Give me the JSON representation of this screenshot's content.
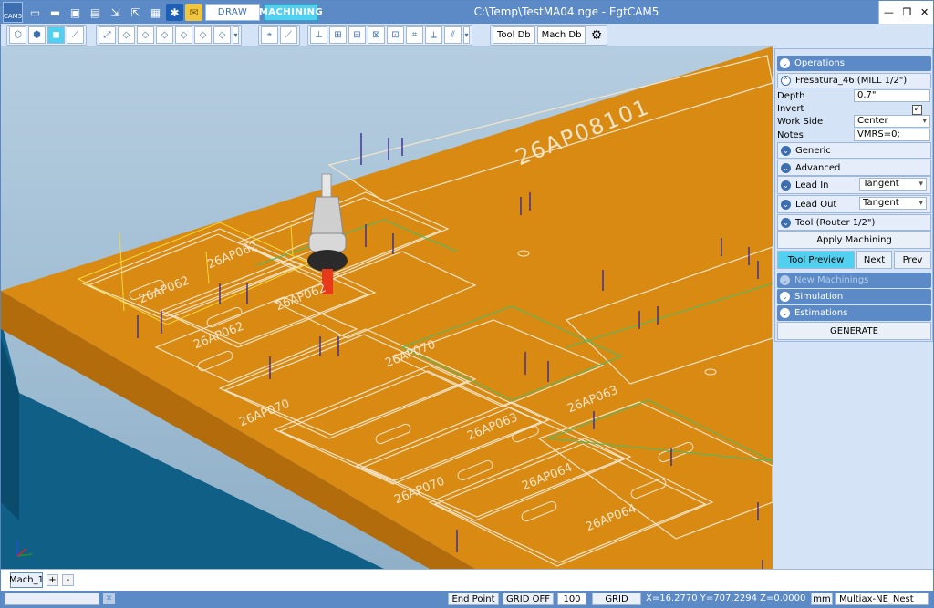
{
  "titlebar": {
    "title": "C:\\Temp\\TestMA04.nge - EgtCAM5",
    "app_icon_label": "CAM5",
    "tab_draw": "DRAW",
    "tab_machining": "MACHINING",
    "minimize": "—",
    "maximize": "❐",
    "close": "✕"
  },
  "toolbar": {
    "tool_db": "Tool Db",
    "mach_db": "Mach Db"
  },
  "panel": {
    "operations": "Operations",
    "current_op": "Fresatura_46 (MILL 1/2\")",
    "depth_label": "Depth",
    "depth_value": "0.7\"",
    "invert_label": "Invert",
    "invert_checked": true,
    "work_side_label": "Work Side",
    "work_side_value": "Center",
    "notes_label": "Notes",
    "notes_value": "VMRS=0;",
    "generic": "Generic",
    "advanced": "Advanced",
    "lead_in_label": "Lead In",
    "lead_in_value": "Tangent",
    "lead_out_label": "Lead Out",
    "lead_out_value": "Tangent",
    "tool_label": "Tool (Router 1/2\")",
    "apply_machining": "Apply Machining",
    "tool_preview": "Tool Preview",
    "next": "Next",
    "prev": "Prev",
    "new_machinings": "New Machinings",
    "simulation": "Simulation",
    "estimations": "Estimations",
    "generate": "GENERATE"
  },
  "viewport": {
    "part_labels": [
      "26AP08101",
      "26AP062",
      "26AP062",
      "26AP062",
      "26AP062",
      "26AP070",
      "26AP070",
      "26AP064",
      "26AP070",
      "26AP064",
      "26AP063",
      "26AP063"
    ]
  },
  "machbar": {
    "tab": "Mach_1",
    "add": "+",
    "remove": "-"
  },
  "statusbar": {
    "end_point": "End Point",
    "grid_off": "GRID OFF",
    "grid_value": "100",
    "grid": "GRID",
    "coords": "X=16.2770 Y=707.2294 Z=0.0000",
    "units": "mm",
    "machine": "Multiax-NE_Nest"
  },
  "colors": {
    "chrome_blue": "#5b8ac6",
    "accent_cyan": "#51d0ef",
    "panel_bg": "#d4e4f6",
    "sheet_orange": "#d98a13"
  }
}
